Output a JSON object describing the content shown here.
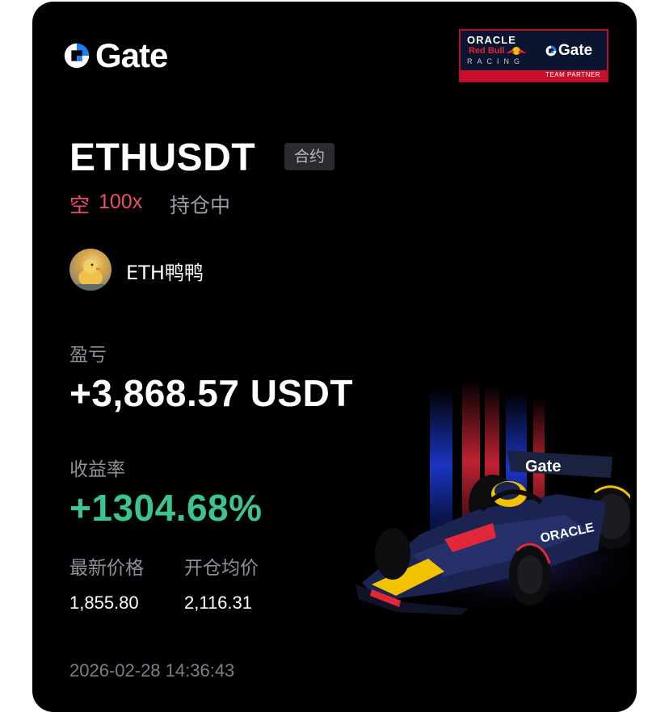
{
  "brand": {
    "logo_text": "Gate",
    "accent_color": "#1f7cf5"
  },
  "partner_badge": {
    "line1": "ORACLE",
    "line2": "Red Bull",
    "line3": "RACING",
    "gate_text": "Gate",
    "band_text": "TEAM PARTNER"
  },
  "contract": {
    "symbol": "ETHUSDT",
    "type_badge": "合约",
    "side": "空",
    "leverage": "100x",
    "status": "持仓中"
  },
  "user": {
    "name": "ETH鸭鸭"
  },
  "pnl": {
    "label": "盈亏",
    "value": "+3,868.57 USDT"
  },
  "roi": {
    "label": "收益率",
    "value": "+1304.68%",
    "color": "#3cc48f"
  },
  "prices": {
    "latest_label": "最新价格",
    "latest_value": "1,855.80",
    "entry_label": "开仓均价",
    "entry_value": "2,116.31"
  },
  "timestamp": "2026-02-28 14:36:43",
  "car": {
    "wing_text": "Gate",
    "sidepod_text": "ORACLE"
  },
  "colors": {
    "short": "#ea4d66",
    "profit": "#3cc48f",
    "card_bg": "#000000"
  }
}
